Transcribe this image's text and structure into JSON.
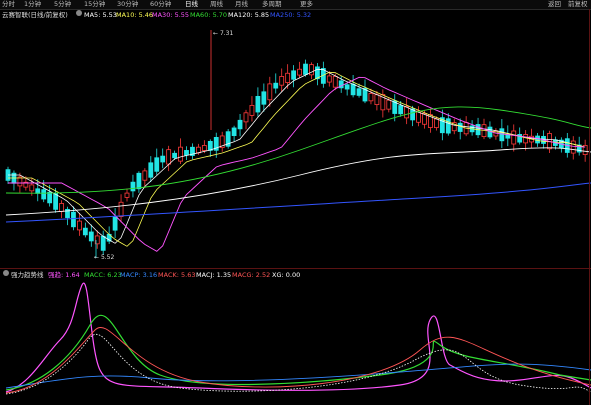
{
  "toolbar": {
    "tabs": [
      "分时",
      "1分钟",
      "5分钟",
      "15分钟",
      "30分钟",
      "60分钟",
      "日线",
      "周线",
      "月线",
      "多周期",
      "更多"
    ],
    "active_tab": "日线",
    "right_items": [
      "返回",
      "前复权"
    ]
  },
  "main_legend": {
    "name": "云赛智联(日线/前复权)",
    "items": [
      {
        "label": "MA5: 5.53",
        "color": "#ffffff"
      },
      {
        "label": "MA10: 5.46",
        "color": "#ffff55"
      },
      {
        "label": "MA30: 5.55",
        "color": "#ff55ff"
      },
      {
        "label": "MA60: 5.70",
        "color": "#33dd33"
      },
      {
        "label": "MA120: 5.85",
        "color": "#ffffff"
      },
      {
        "label": "MA250: 5.32",
        "color": "#3355ff"
      }
    ]
  },
  "annotations": {
    "high": "7.31",
    "low": "5.52"
  },
  "sub_legend": {
    "name": "强力趋势线",
    "items": [
      {
        "label": "强趋: 1.64",
        "color": "#ff55ff"
      },
      {
        "label": "MACC: 6.23",
        "color": "#33dd33"
      },
      {
        "label": "MACP: 3.16",
        "color": "#3388ff"
      },
      {
        "label": "MACK: 5.63",
        "color": "#ff5555"
      },
      {
        "label": "MACJ: 1.35",
        "color": "#ffffff"
      },
      {
        "label": "MACG: 2.52",
        "color": "#ff5555"
      },
      {
        "label": "XG: 0.00",
        "color": "#ffffff"
      }
    ]
  },
  "colors": {
    "up": "#ff3b3b",
    "down": "#22e5e5",
    "ma5": "#ffffff",
    "ma10": "#ffff55",
    "ma30": "#ff55ff",
    "ma60": "#33dd33",
    "ma250": "#3355ff"
  }
}
